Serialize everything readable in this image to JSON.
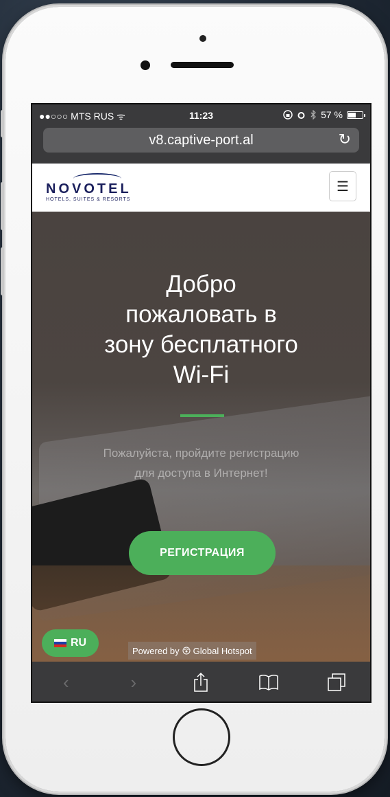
{
  "status": {
    "carrier": "●●○○○ MTS RUS",
    "wifi": "ᯤ",
    "time": "11:23",
    "battery_text": "57 %",
    "battery_level": 0.57,
    "icons": [
      "rotation-lock-icon",
      "alarm-icon",
      "bluetooth-icon"
    ]
  },
  "browser": {
    "url": "v8.captive-port.al",
    "reload_icon": "reload-icon"
  },
  "nav": {
    "logo_word": "NOVOTEL",
    "logo_sub": "HOTELS, SUITES & RESORTS",
    "menu_icon": "☰"
  },
  "hero": {
    "title_lines": [
      "Добро",
      "пожаловать в",
      "зону бесплатного",
      "Wi-Fi"
    ],
    "subtitle_lines": [
      "Пожалуйста, пройдите регистрацию",
      "для доступа в Интернет!"
    ],
    "register_label": "РЕГИСТРАЦИЯ",
    "accent_color": "#4caf5a"
  },
  "footer": {
    "lang_label": "RU",
    "powered_prefix": "Powered by",
    "powered_brand": "Global Hotspot"
  },
  "toolbar": {
    "back": "‹",
    "forward": "›",
    "share_icon": "share-icon",
    "bookmarks_icon": "bookmarks-icon",
    "tabs_icon": "tabs-icon"
  }
}
